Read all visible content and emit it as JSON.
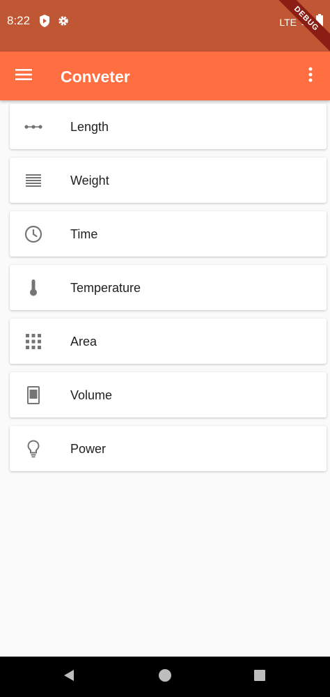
{
  "status_bar": {
    "time": "8:22",
    "network": "LTE",
    "debug_banner": "DEBUG",
    "color": "#bf5634"
  },
  "app_bar": {
    "title": "Conveter",
    "color": "#ff6e40",
    "menu_icon": "menu-icon",
    "more_icon": "more-vert-icon"
  },
  "categories": [
    {
      "label": "Length",
      "icon": "length-icon"
    },
    {
      "label": "Weight",
      "icon": "weight-icon"
    },
    {
      "label": "Time",
      "icon": "clock-icon"
    },
    {
      "label": "Temperature",
      "icon": "thermometer-icon"
    },
    {
      "label": "Area",
      "icon": "grid-icon"
    },
    {
      "label": "Volume",
      "icon": "volume-icon"
    },
    {
      "label": "Power",
      "icon": "lightbulb-icon"
    }
  ],
  "nav_bar": {
    "buttons": [
      "back-icon",
      "home-icon",
      "recents-icon"
    ]
  }
}
